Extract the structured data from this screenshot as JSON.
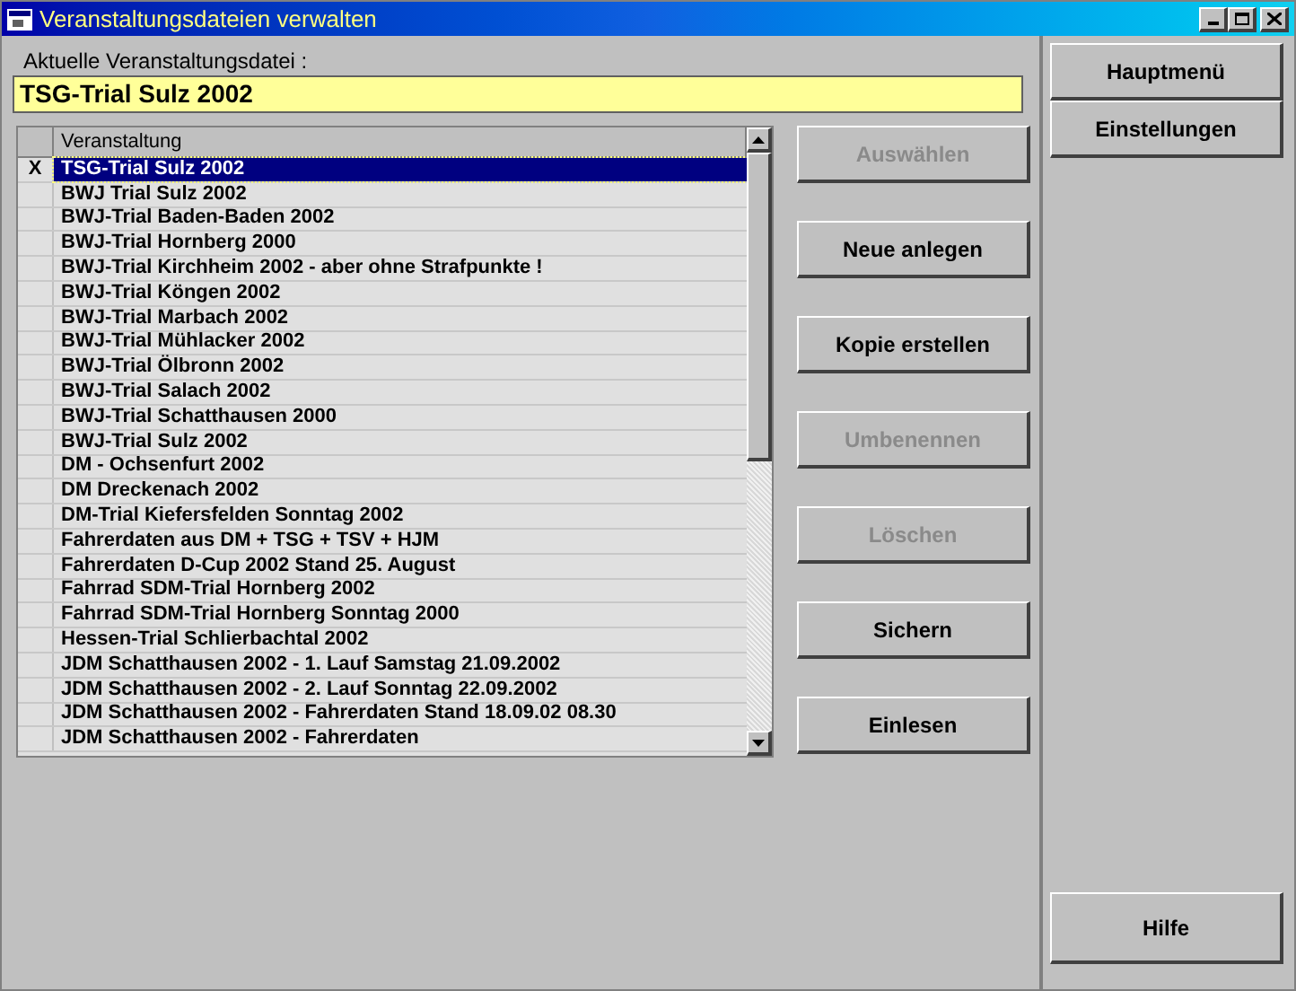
{
  "window": {
    "title": "Veranstaltungsdateien verwalten"
  },
  "current": {
    "label": "Aktuelle Veranstaltungsdatei :",
    "value": "TSG-Trial Sulz 2002"
  },
  "table": {
    "columns": [
      "Veranstaltung"
    ],
    "rows": [
      {
        "marker": "X",
        "name": "TSG-Trial Sulz 2002",
        "selected": true
      },
      {
        "name": "BWJ Trial Sulz 2002",
        "selected": false
      },
      {
        "name": "BWJ-Trial Baden-Baden 2002",
        "selected": false
      },
      {
        "name": "BWJ-Trial Hornberg 2000",
        "selected": false
      },
      {
        "name": "BWJ-Trial Kirchheim 2002 - aber ohne Strafpunkte !",
        "selected": false
      },
      {
        "name": "BWJ-Trial Köngen 2002",
        "selected": false
      },
      {
        "name": "BWJ-Trial Marbach 2002",
        "selected": false
      },
      {
        "name": "BWJ-Trial Mühlacker 2002",
        "selected": false
      },
      {
        "name": "BWJ-Trial Ölbronn 2002",
        "selected": false
      },
      {
        "name": "BWJ-Trial Salach 2002",
        "selected": false
      },
      {
        "name": "BWJ-Trial Schatthausen 2000",
        "selected": false
      },
      {
        "name": "BWJ-Trial Sulz 2002",
        "selected": false
      },
      {
        "name": "DM - Ochsenfurt 2002",
        "selected": false
      },
      {
        "name": "DM Dreckenach 2002",
        "selected": false
      },
      {
        "name": "DM-Trial Kiefersfelden Sonntag 2002",
        "selected": false
      },
      {
        "name": "Fahrerdaten aus DM + TSG + TSV + HJM",
        "selected": false
      },
      {
        "name": "Fahrerdaten D-Cup 2002 Stand 25. August",
        "selected": false
      },
      {
        "name": "Fahrrad SDM-Trial Hornberg 2002",
        "selected": false
      },
      {
        "name": "Fahrrad SDM-Trial Hornberg Sonntag 2000",
        "selected": false
      },
      {
        "name": "Hessen-Trial Schlierbachtal 2002",
        "selected": false
      },
      {
        "name": "JDM Schatthausen 2002 - 1. Lauf Samstag 21.09.2002",
        "selected": false
      },
      {
        "name": "JDM Schatthausen 2002 - 2. Lauf Sonntag 22.09.2002",
        "selected": false
      },
      {
        "name": "JDM Schatthausen 2002 - Fahrerdaten Stand 18.09.02 08.30",
        "selected": false
      },
      {
        "name": "JDM Schatthausen 2002 - Fahrerdaten",
        "selected": false
      }
    ]
  },
  "actions": [
    {
      "label": "Auswählen",
      "disabled": true
    },
    {
      "label": "Neue anlegen",
      "disabled": false
    },
    {
      "label": "Kopie erstellen",
      "disabled": false
    },
    {
      "label": "Umbenennen",
      "disabled": true
    },
    {
      "label": "Löschen",
      "disabled": true
    },
    {
      "label": "Sichern",
      "disabled": false
    },
    {
      "label": "Einlesen",
      "disabled": false
    }
  ],
  "sidebar": {
    "top_buttons": [
      "Hauptmenü",
      "Einstellungen"
    ],
    "bottom_button": "Hilfe"
  }
}
